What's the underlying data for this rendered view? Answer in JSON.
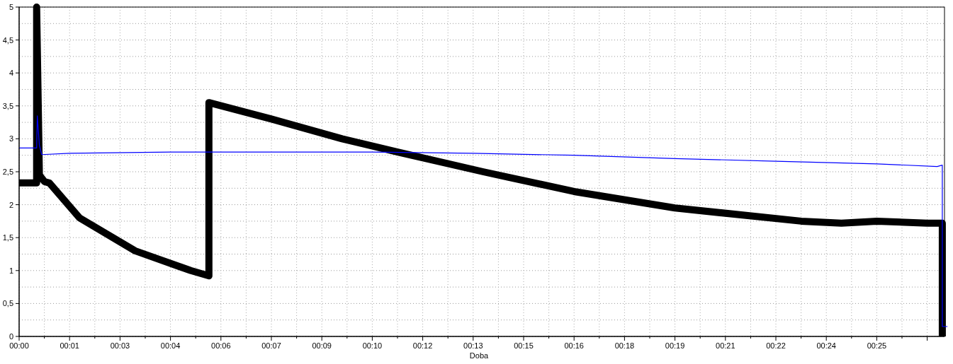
{
  "chart": {
    "chart_data": {
      "type": "line",
      "xlabel": "Doba",
      "grid": true,
      "xlim": [
        0,
        27.05
      ],
      "ylim": [
        0,
        5
      ],
      "yticks": [
        {
          "value": 0,
          "label": "0"
        },
        {
          "value": 0.5,
          "label": "0,5"
        },
        {
          "value": 1,
          "label": "1"
        },
        {
          "value": 1.5,
          "label": "1,5"
        },
        {
          "value": 2,
          "label": "2"
        },
        {
          "value": 2.5,
          "label": "2,5"
        },
        {
          "value": 3,
          "label": "3"
        },
        {
          "value": 3.5,
          "label": "3,5"
        },
        {
          "value": 4,
          "label": "4"
        },
        {
          "value": 4.5,
          "label": "4,5"
        },
        {
          "value": 5,
          "label": "5"
        }
      ],
      "xticks": [
        {
          "value": 0,
          "label": "00:00"
        },
        {
          "value": 1.47,
          "label": "00:01"
        },
        {
          "value": 2.94,
          "label": "00:03"
        },
        {
          "value": 4.41,
          "label": "00:04"
        },
        {
          "value": 5.88,
          "label": "00:06"
        },
        {
          "value": 7.35,
          "label": "00:07"
        },
        {
          "value": 8.82,
          "label": "00:09"
        },
        {
          "value": 10.29,
          "label": "00:10"
        },
        {
          "value": 11.76,
          "label": "00:12"
        },
        {
          "value": 13.23,
          "label": "00:13"
        },
        {
          "value": 14.7,
          "label": "00:15"
        },
        {
          "value": 16.17,
          "label": "00:16"
        },
        {
          "value": 17.64,
          "label": "00:18"
        },
        {
          "value": 19.11,
          "label": "00:19"
        },
        {
          "value": 20.58,
          "label": "00:21"
        },
        {
          "value": 22.05,
          "label": "00:22"
        },
        {
          "value": 23.52,
          "label": "00:24"
        },
        {
          "value": 24.99,
          "label": "00:25"
        }
      ],
      "series": [
        {
          "color": "#000000",
          "x": [
            0,
            0.51,
            0.51,
            0.59,
            0.74,
            0.88,
            1.76,
            3.38,
            5,
            5.53,
            5.53,
            7.35,
            9.41,
            11.03,
            13.52,
            16.17,
            19.11,
            22.79,
            23.96,
            24.99,
            26.46,
            26.9,
            26.9
          ],
          "values": [
            2.33,
            2.33,
            5,
            2.45,
            2.35,
            2.33,
            1.8,
            1.3,
            1.0,
            0.92,
            3.55,
            3.3,
            3.0,
            2.8,
            2.5,
            2.2,
            1.95,
            1.75,
            1.72,
            1.75,
            1.72,
            1.72,
            0
          ]
        },
        {
          "color": "#0000ff",
          "x": [
            0,
            0.51,
            0.53,
            0.59,
            0.66,
            1.47,
            4.41,
            10.29,
            13.23,
            16.17,
            19.11,
            22.05,
            24.99,
            26.75,
            26.9,
            26.9,
            27.05
          ],
          "values": [
            2.86,
            2.86,
            3.35,
            2.9,
            2.76,
            2.78,
            2.8,
            2.8,
            2.78,
            2.75,
            2.7,
            2.66,
            2.62,
            2.58,
            2.6,
            0.15,
            0.15
          ]
        }
      ]
    }
  }
}
